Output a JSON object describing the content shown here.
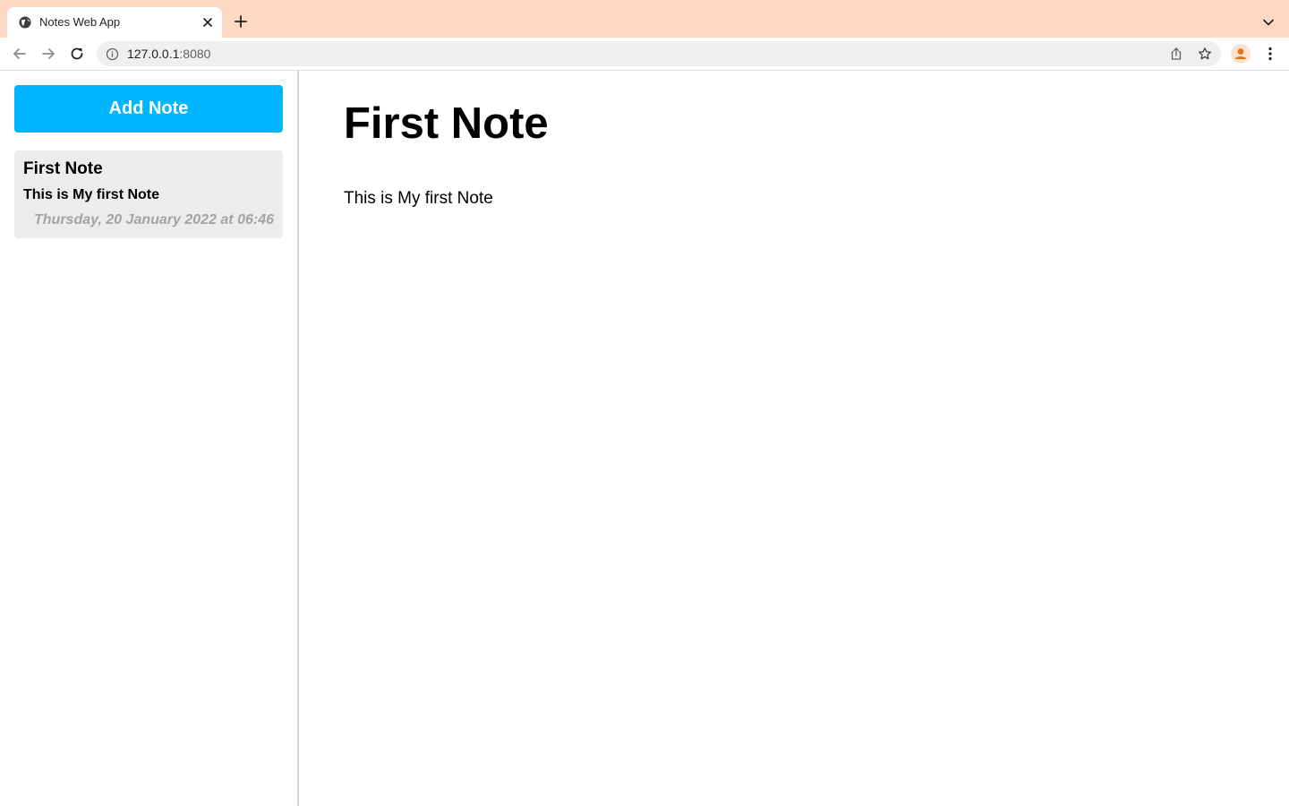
{
  "browser": {
    "tab": {
      "title": "Notes Web App"
    },
    "address": {
      "host": "127.0.0.1",
      "port": ":8080"
    },
    "colors": {
      "tabstrip": "#fdd9c4",
      "avatar_icon": "#e8710a"
    }
  },
  "app": {
    "add_button": {
      "label": "Add Note",
      "color": "#00b7ff"
    },
    "notes": [
      {
        "title": "First Note",
        "preview": "This is My first Note",
        "date": "Thursday, 20 January 2022 at 06:46"
      }
    ],
    "active_note": {
      "title": "First Note",
      "body": "This is My first Note"
    }
  }
}
